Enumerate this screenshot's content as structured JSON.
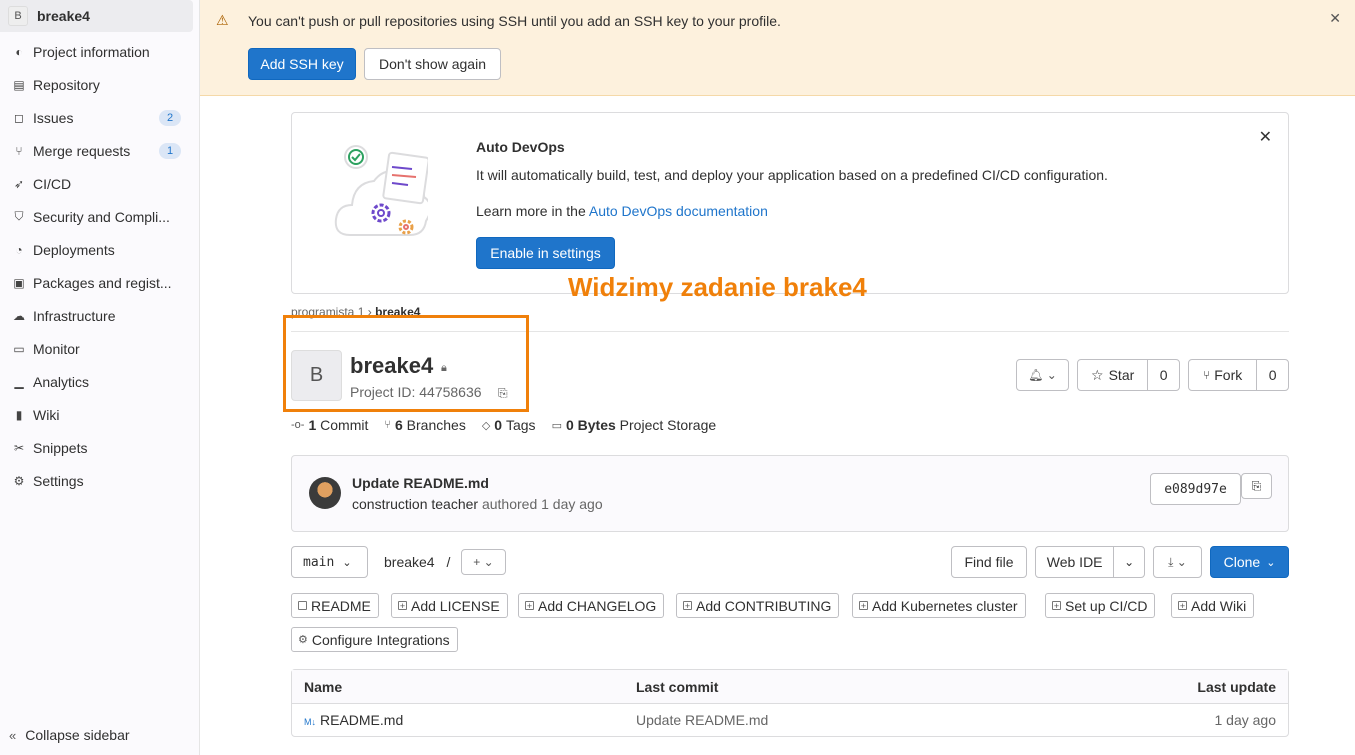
{
  "sidebar": {
    "project_avatar": "B",
    "project_name": "breake4",
    "items": [
      {
        "label": "Project information",
        "icon": "info-icon"
      },
      {
        "label": "Repository",
        "icon": "doc-icon"
      },
      {
        "label": "Issues",
        "icon": "issues-icon",
        "badge": "2"
      },
      {
        "label": "Merge requests",
        "icon": "merge-icon",
        "badge": "1"
      },
      {
        "label": "CI/CD",
        "icon": "rocket-icon"
      },
      {
        "label": "Security and Compli...",
        "icon": "shield-icon"
      },
      {
        "label": "Deployments",
        "icon": "deploy-icon"
      },
      {
        "label": "Packages and regist...",
        "icon": "package-icon"
      },
      {
        "label": "Infrastructure",
        "icon": "cloud-icon"
      },
      {
        "label": "Monitor",
        "icon": "monitor-icon"
      },
      {
        "label": "Analytics",
        "icon": "chart-icon"
      },
      {
        "label": "Wiki",
        "icon": "book-icon"
      },
      {
        "label": "Snippets",
        "icon": "scissors-icon"
      },
      {
        "label": "Settings",
        "icon": "gear-icon"
      }
    ],
    "collapse_label": "Collapse sidebar"
  },
  "alert": {
    "text": "You can't push or pull repositories using SSH until you add an SSH key to your profile.",
    "add_key": "Add SSH key",
    "dont_show": "Don't show again"
  },
  "devops": {
    "title": "Auto DevOps",
    "description": "It will automatically build, test, and deploy your application based on a predefined CI/CD configuration.",
    "learn_prefix": "Learn more in the ",
    "learn_link": "Auto DevOps documentation",
    "enable": "Enable in settings"
  },
  "annotation": "Widzimy zadanie brake4",
  "breadcrumb": {
    "parent": "programista 1",
    "sep": "›",
    "current": "breake4"
  },
  "project": {
    "avatar": "B",
    "title": "breake4",
    "id_text": "Project ID: 44758636"
  },
  "actions": {
    "star": "Star",
    "star_count": "0",
    "fork": "Fork",
    "fork_count": "0"
  },
  "stats": [
    {
      "num": "1",
      "label": "Commit"
    },
    {
      "num": "6",
      "label": "Branches"
    },
    {
      "num": "0",
      "label": "Tags"
    },
    {
      "num": "0 Bytes",
      "label": "Project Storage"
    }
  ],
  "commit": {
    "title": "Update README.md",
    "author": "construction teacher",
    "meta": "authored 1 day ago",
    "sha": "e089d97e"
  },
  "repo": {
    "branch": "main",
    "path": "breake4",
    "path_sep": "/",
    "find_file": "Find file",
    "web_ide": "Web IDE",
    "clone": "Clone"
  },
  "chips": [
    "README",
    "Add LICENSE",
    "Add CHANGELOG",
    "Add CONTRIBUTING",
    "Add Kubernetes cluster",
    "Set up CI/CD",
    "Add Wiki",
    "Configure Integrations"
  ],
  "table": {
    "headers": [
      "Name",
      "Last commit",
      "Last update"
    ],
    "rows": [
      {
        "name": "README.md",
        "commit": "Update README.md",
        "update": "1 day ago"
      }
    ]
  }
}
